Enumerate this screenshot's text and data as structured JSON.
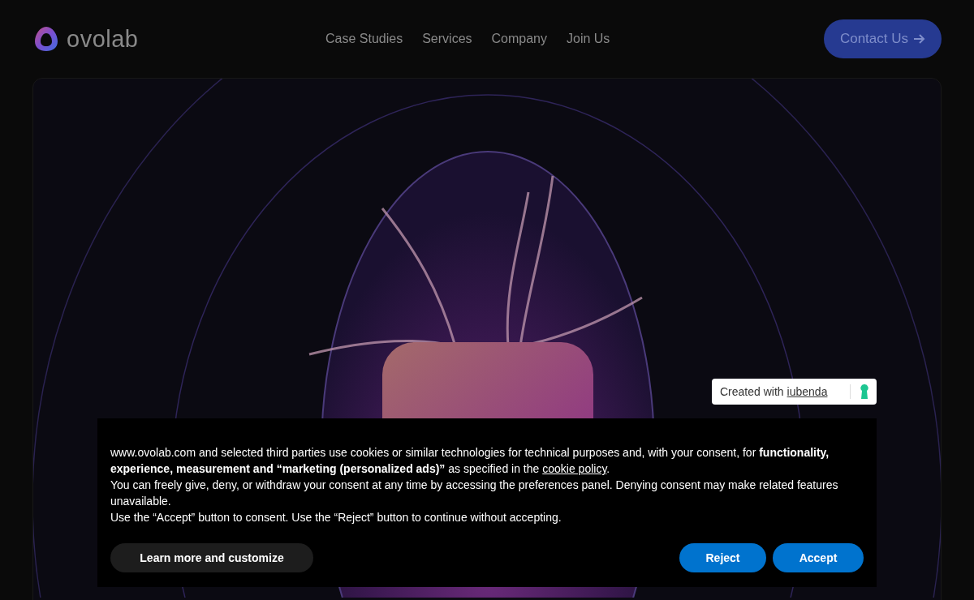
{
  "header": {
    "logo": "ovolab",
    "nav": [
      {
        "label": "Case Studies"
      },
      {
        "label": "Services"
      },
      {
        "label": "Company"
      },
      {
        "label": "Join Us"
      }
    ],
    "cta": "Contact Us"
  },
  "badge": {
    "text": "Created with",
    "link": "iubenda"
  },
  "consent": {
    "intro": "www.ovolab.com and selected third parties use cookies or similar technologies for technical purposes and, with your consent, for **functionality, experience, measurement and “marketing (personalized ads)”** as specified in the",
    "link": "cookie policy",
    "after": ".",
    "paragraphs": [
      "You can freely give, deny, or withdraw your consent at any time by accessing the preferences panel. Denying consent may make related features unavailable.",
      "Use the “Accept” button to consent. Use the “Reject” button to continue without accepting."
    ],
    "buttons": [
      {
        "label": "Learn more and customize",
        "kind": "secondary"
      },
      {
        "label": "Reject",
        "kind": "primary"
      },
      {
        "label": "Accept",
        "kind": "primary"
      }
    ]
  }
}
